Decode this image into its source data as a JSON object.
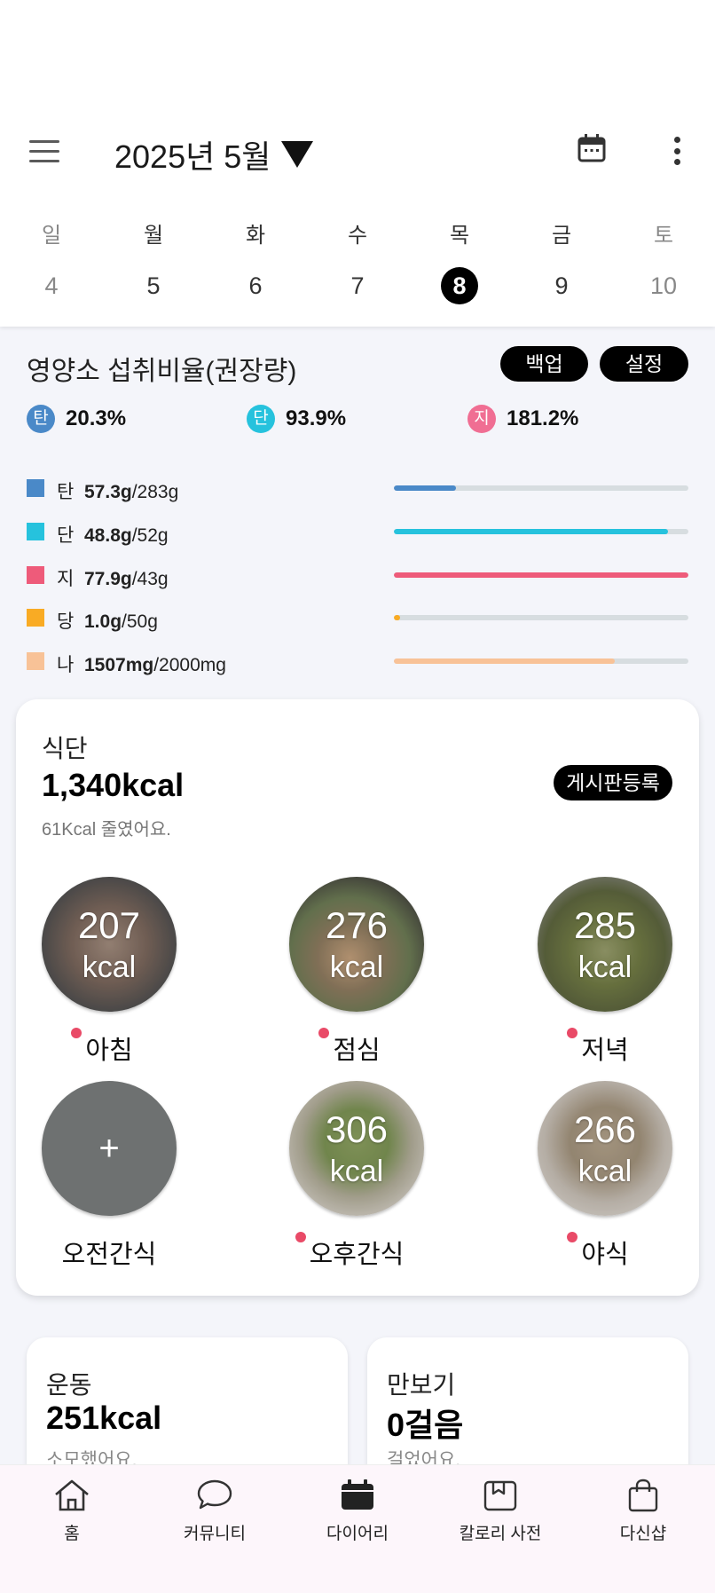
{
  "header": {
    "month_label": "2025년 5월",
    "menu_icon": "hamburger-icon",
    "calendar_icon": "calendar-icon",
    "more_icon": "more-vertical-icon"
  },
  "week": {
    "days": [
      "일",
      "월",
      "화",
      "수",
      "목",
      "금",
      "토"
    ],
    "dates": [
      "4",
      "5",
      "6",
      "7",
      "8",
      "9",
      "10"
    ],
    "selected_index": 4
  },
  "nutrition": {
    "title": "영양소 섭취비율(권장량)",
    "backup_label": "백업",
    "settings_label": "설정",
    "ratios": [
      {
        "badge": "탄",
        "value": "20.3%",
        "color": "#4a89c8"
      },
      {
        "badge": "단",
        "value": "93.9%",
        "color": "#26c2dd"
      },
      {
        "badge": "지",
        "value": "181.2%",
        "color": "#f06e93"
      }
    ],
    "rows": [
      {
        "name": "탄",
        "amount": "57.3g",
        "target": "/283g",
        "progress": 0.21,
        "color": "#4a89c8"
      },
      {
        "name": "단",
        "amount": "48.8g",
        "target": "/52g",
        "progress": 0.93,
        "color": "#26c2dd"
      },
      {
        "name": "지",
        "amount": "77.9g",
        "target": "/43g",
        "progress": 1.0,
        "color": "#ee5b7a"
      },
      {
        "name": "당",
        "amount": "1.0g",
        "target": "/50g",
        "progress": 0.02,
        "color": "#f9ab24"
      },
      {
        "name": "나",
        "amount": "1507mg",
        "target": "/2000mg",
        "progress": 0.75,
        "color": "#f8c297"
      }
    ]
  },
  "meals": {
    "title": "식단",
    "total": "1,340kcal",
    "subtitle": "61Kcal 줄였어요.",
    "board_button": "게시판등록",
    "unit": "kcal",
    "add_symbol": "+",
    "items": [
      {
        "name": "아침",
        "kcal": "207"
      },
      {
        "name": "점심",
        "kcal": "276"
      },
      {
        "name": "저녁",
        "kcal": "285"
      },
      {
        "name": "오전간식",
        "kcal": ""
      },
      {
        "name": "오후간식",
        "kcal": "306"
      },
      {
        "name": "야식",
        "kcal": "266"
      }
    ]
  },
  "exercise": {
    "title": "운동",
    "value": "251kcal",
    "sub": "소모했어요."
  },
  "steps": {
    "title": "만보기",
    "value": "0걸음",
    "sub": "걸었어요."
  },
  "bottom_nav": [
    {
      "label": "홈",
      "icon": "home-icon"
    },
    {
      "label": "커뮤니티",
      "icon": "chat-bubble-icon"
    },
    {
      "label": "다이어리",
      "icon": "diary-calendar-icon"
    },
    {
      "label": "칼로리 사전",
      "icon": "book-icon"
    },
    {
      "label": "다신샵",
      "icon": "shopping-bag-icon"
    }
  ]
}
